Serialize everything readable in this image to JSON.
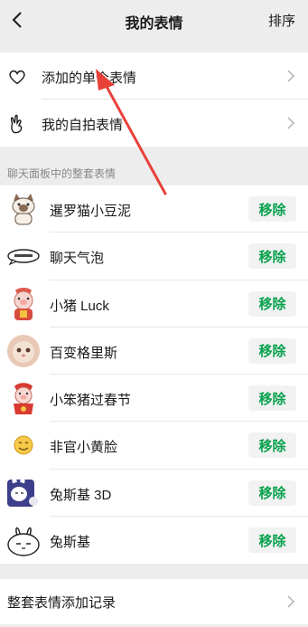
{
  "header": {
    "back_icon": "chevron-left-icon",
    "title": "我的表情",
    "sort_label": "排序"
  },
  "top_items": [
    {
      "icon": "heart-icon",
      "label": "添加的单个表情"
    },
    {
      "icon": "hand-gesture-icon",
      "label": "我的自拍表情"
    }
  ],
  "section_label": "聊天面板中的整套表情",
  "packs": [
    {
      "name": "暹罗猫小豆泥",
      "thumb": "siamese-cat",
      "action": "移除"
    },
    {
      "name": "聊天气泡",
      "thumb": "chat-bubble",
      "action": "移除"
    },
    {
      "name": "小猪 Luck",
      "thumb": "pig-luck",
      "action": "移除"
    },
    {
      "name": "百变格里斯",
      "thumb": "fluffy-cat",
      "action": "移除"
    },
    {
      "name": "小笨猪过春节",
      "thumb": "pig-spring-festival",
      "action": "移除"
    },
    {
      "name": "非官小黄脸",
      "thumb": "yellow-face",
      "action": "移除"
    },
    {
      "name": "兔斯基 3D",
      "thumb": "tuzki-3d",
      "action": "移除"
    },
    {
      "name": "兔斯基",
      "thumb": "tuzki",
      "action": "移除"
    }
  ],
  "bottom_item": {
    "label": "整套表情添加记录"
  },
  "colors": {
    "background": "#ededed",
    "accent_green": "#07a14d",
    "annotation_arrow": "#e8413a"
  }
}
